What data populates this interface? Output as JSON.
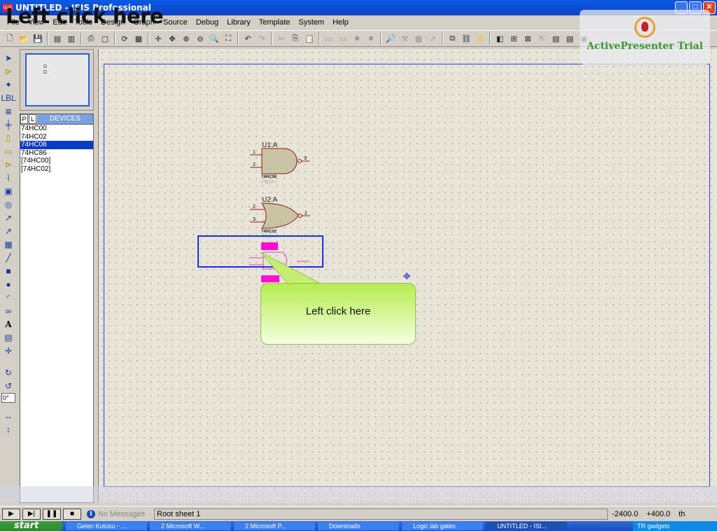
{
  "window": {
    "title": "UNTITLED - ISIS Professional",
    "app_icon": "ISIS"
  },
  "overlay": {
    "title": "Left click here"
  },
  "watermark": {
    "text": "ActivePresenter Trial"
  },
  "menu": [
    "File",
    "View",
    "Edit",
    "Tools",
    "Design",
    "Graph",
    "Source",
    "Debug",
    "Library",
    "Template",
    "System",
    "Help"
  ],
  "devices": {
    "tab_p": "P",
    "tab_l": "L",
    "header": "DEVICES",
    "items": [
      "74HC00",
      "74HC02",
      "74HC08",
      "74HC86",
      "[74HC00]",
      "[74HC02]"
    ],
    "selected_index": 2
  },
  "rotation": {
    "value": "0°"
  },
  "schematic": {
    "u1": {
      "ref": "U1:A",
      "part": "74HC08",
      "text": "<TEXT>",
      "pin_in1": "1",
      "pin_in2": "2",
      "pin_out": "3"
    },
    "u2": {
      "ref": "U2:A",
      "part": "74HC02",
      "text": "<TEXT>",
      "pin_in1": "2",
      "pin_in2": "3",
      "pin_out": "1"
    }
  },
  "callout": {
    "text": "Left click here"
  },
  "status": {
    "messages": "No Messages",
    "sheet": "Root sheet 1",
    "x": "-2400.0",
    "y": "+400.0",
    "unit": "th"
  },
  "taskbar": {
    "start": "start",
    "tasks": [
      "Gelen Kutusu - ...",
      "2 Microsoft W...",
      "2 Microsoft P...",
      "Downloads",
      "Logic lab gates",
      "UNTITLED - ISI..."
    ],
    "tray": "TR  gadgets"
  }
}
